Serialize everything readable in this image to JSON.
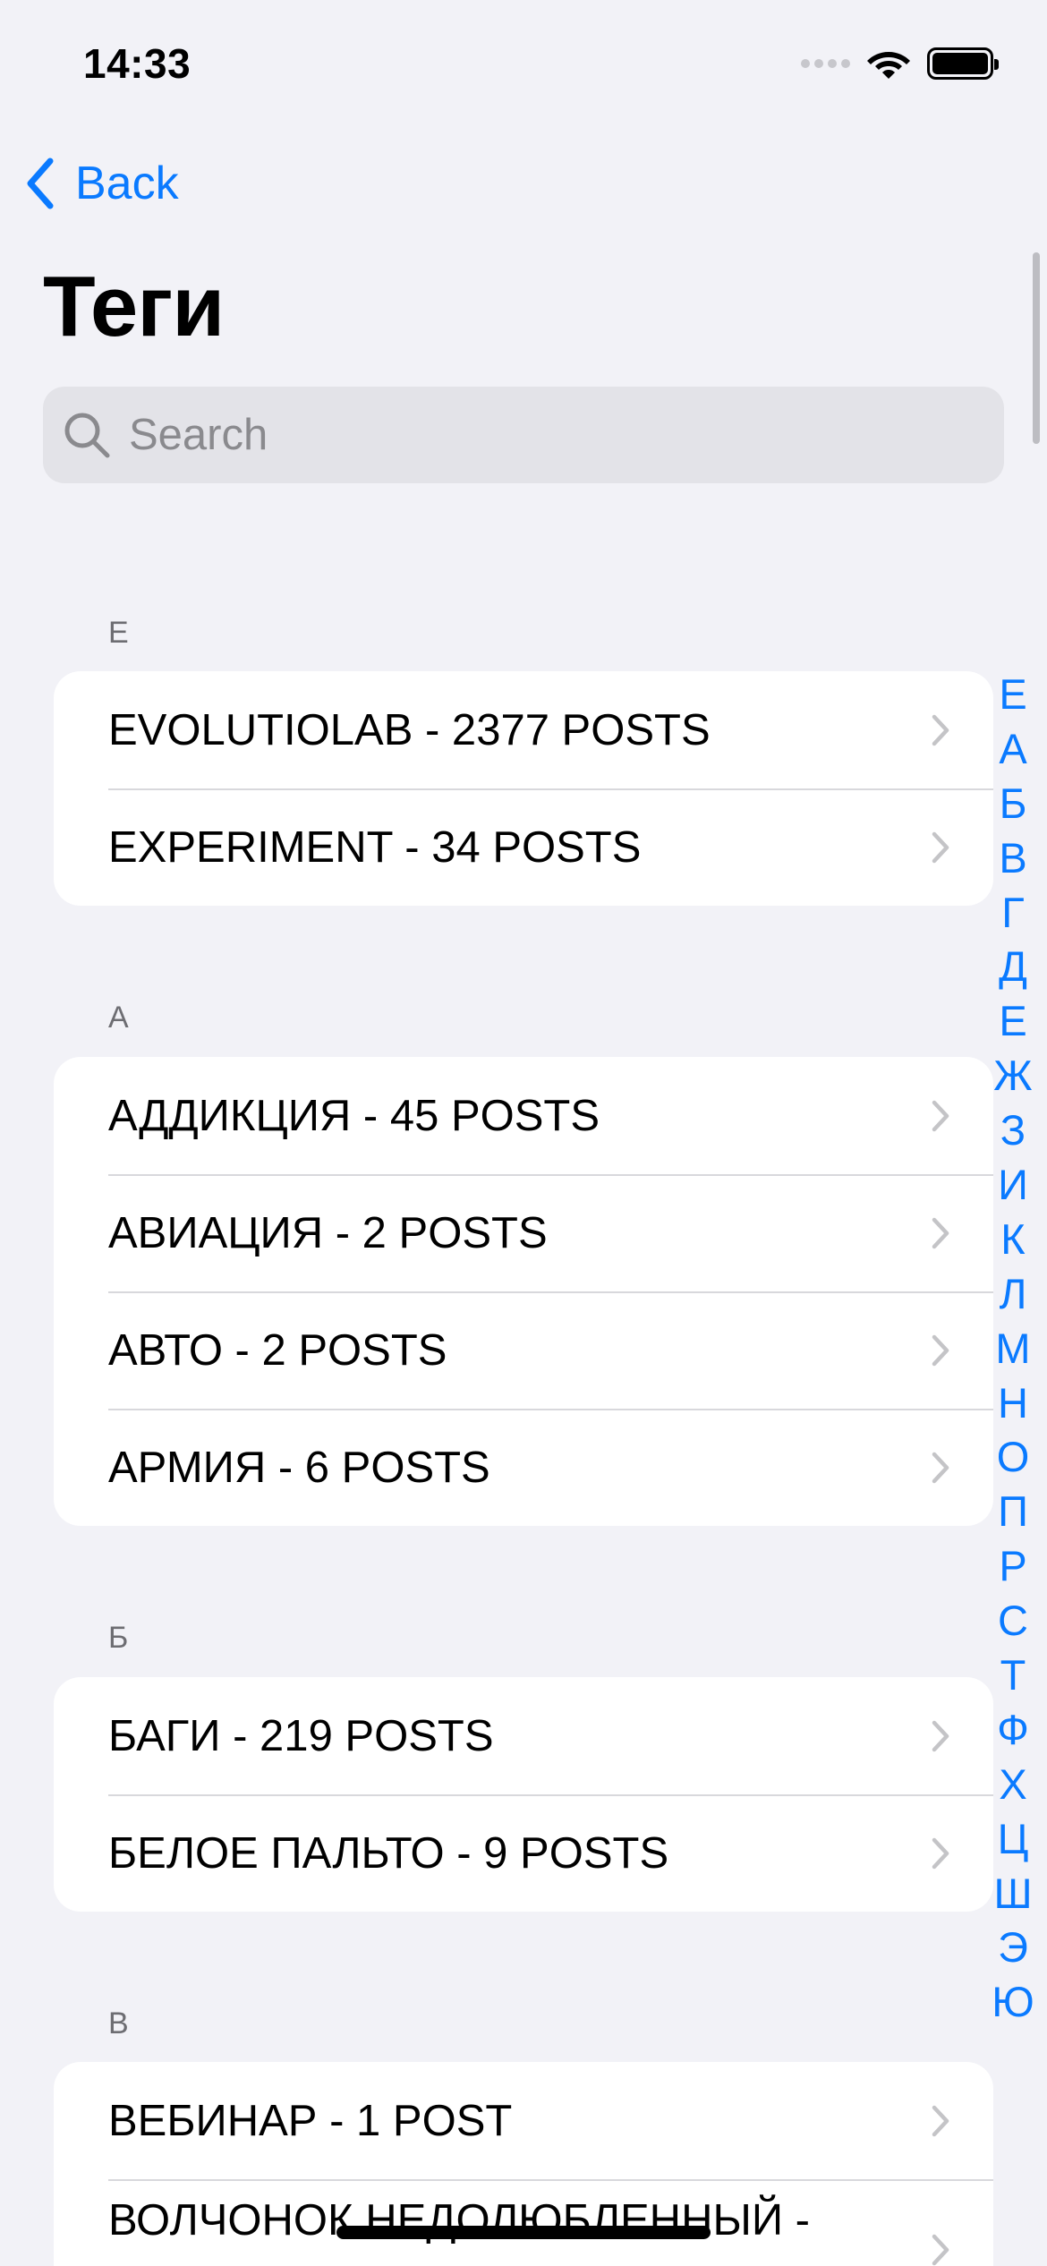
{
  "status_bar": {
    "time": "14:33"
  },
  "nav": {
    "back_label": "Back",
    "title": "Теги"
  },
  "search": {
    "placeholder": "Search"
  },
  "sections": [
    {
      "header": "E",
      "items": [
        "EVOLUTIOLAB - 2377 POSTS",
        "EXPERIMENT - 34 POSTS"
      ]
    },
    {
      "header": "А",
      "items": [
        "АДДИКЦИЯ - 45 POSTS",
        "АВИАЦИЯ - 2 POSTS",
        "АВТО - 2 POSTS",
        "АРМИЯ - 6 POSTS"
      ]
    },
    {
      "header": "Б",
      "items": [
        "БАГИ - 219 POSTS",
        "БЕЛОЕ ПАЛЬТО - 9 POSTS"
      ]
    },
    {
      "header": "В",
      "items": [
        "ВЕБИНАР - 1 POST",
        "ВОЛЧОНОК НЕДОЛЮБЛЕННЫЙ -"
      ]
    }
  ],
  "index_letters": [
    "E",
    "А",
    "Б",
    "В",
    "Г",
    "Д",
    "Е",
    "Ж",
    "З",
    "И",
    "К",
    "Л",
    "М",
    "Н",
    "О",
    "П",
    "Р",
    "С",
    "Т",
    "Ф",
    "Х",
    "Ц",
    "Ш",
    "Э",
    "Ю"
  ],
  "colors": {
    "accent": "#0A7AFF",
    "background": "#F2F2F7",
    "card": "#FFFFFF",
    "search_bg": "#E3E3E8"
  }
}
